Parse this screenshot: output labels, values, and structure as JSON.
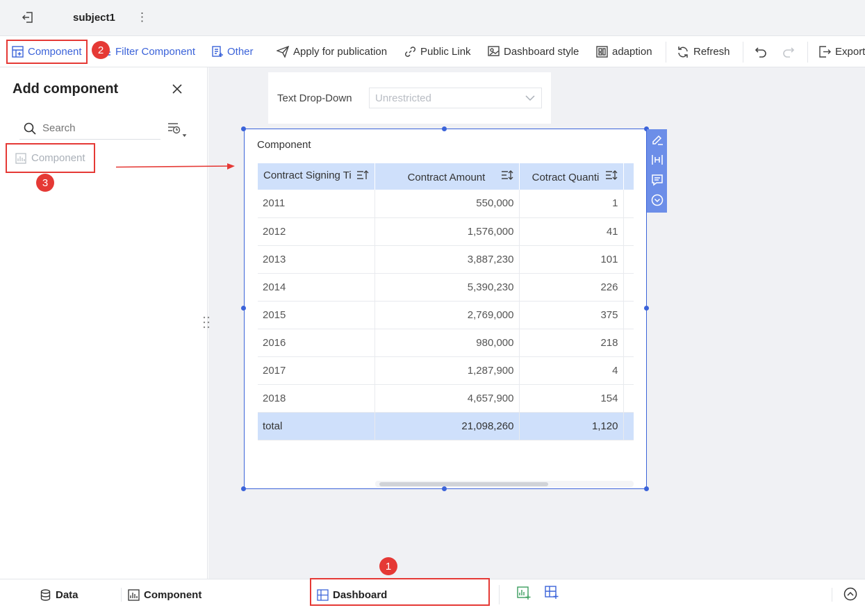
{
  "header": {
    "title": "subject1",
    "more_icon": "⋮"
  },
  "toolbar": {
    "component": "Component",
    "filter_component": "Filter Component",
    "other": "Other",
    "apply_publication": "Apply for publication",
    "public_link": "Public Link",
    "dashboard_style": "Dashboard style",
    "adaption": "adaption",
    "refresh": "Refresh",
    "export": "Export"
  },
  "panel": {
    "title": "Add component",
    "search_placeholder": "Search",
    "component_item": "Component"
  },
  "badges": {
    "one": "1",
    "two": "2",
    "three": "3"
  },
  "filter": {
    "label": "Text Drop-Down",
    "placeholder": "Unrestricted"
  },
  "widget": {
    "title": "Component",
    "columns": [
      "Contract Signing Ti",
      "Contract Amount",
      "Cotract Quanti"
    ],
    "rows": [
      [
        "2011",
        "550,000",
        "1"
      ],
      [
        "2012",
        "1,576,000",
        "41"
      ],
      [
        "2013",
        "3,887,230",
        "101"
      ],
      [
        "2014",
        "5,390,230",
        "226"
      ],
      [
        "2015",
        "2,769,000",
        "375"
      ],
      [
        "2016",
        "980,000",
        "218"
      ],
      [
        "2017",
        "1,287,900",
        "4"
      ],
      [
        "2018",
        "4,657,900",
        "154"
      ]
    ],
    "total": [
      "total",
      "21,098,260",
      "1,120"
    ]
  },
  "bottom": {
    "data": "Data",
    "component": "Component",
    "dashboard": "Dashboard"
  },
  "colors": {
    "accent": "#3b63d9",
    "highlight": "#e53935",
    "table_header": "#cfe0fb"
  }
}
